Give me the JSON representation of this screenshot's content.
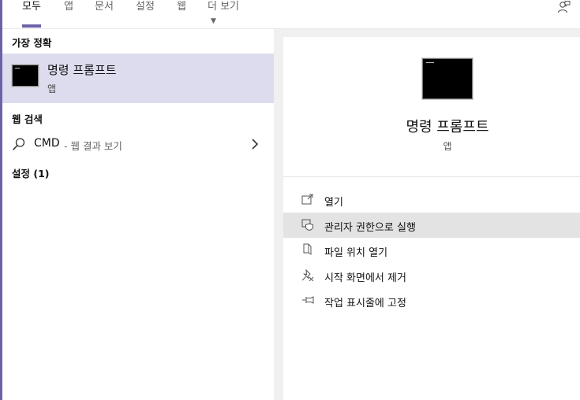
{
  "tabs": [
    {
      "label": "모두",
      "active": true
    },
    {
      "label": "앱"
    },
    {
      "label": "문서"
    },
    {
      "label": "설정"
    },
    {
      "label": "웹"
    },
    {
      "label": "더 보기",
      "dropdown": true
    }
  ],
  "topbar": {
    "feedback_icon": "feedback-icon"
  },
  "left": {
    "best_match_title": "가장 정확",
    "best_match": {
      "name": "명령 프롬프트",
      "type": "앱",
      "icon": "command-prompt-icon"
    },
    "web_title": "웹 검색",
    "web_result": {
      "query": "CMD",
      "hint": "- 웹 결과 보기"
    },
    "settings_title": "설정 (1)"
  },
  "right": {
    "app_name": "명령 프롬프트",
    "app_type": "앱",
    "actions": [
      {
        "label": "열기",
        "icon": "open-icon"
      },
      {
        "label": "관리자 권한으로 실행",
        "icon": "run-as-admin-icon",
        "highlighted": true
      },
      {
        "label": "파일 위치 열기",
        "icon": "file-location-icon"
      },
      {
        "label": "시작 화면에서 제거",
        "icon": "unpin-start-icon"
      },
      {
        "label": "작업 표시줄에 고정",
        "icon": "pin-taskbar-icon"
      }
    ]
  },
  "colors": {
    "accent": "#6b63a8",
    "selection": "#dcdcee",
    "hover": "#e3e3e3"
  }
}
